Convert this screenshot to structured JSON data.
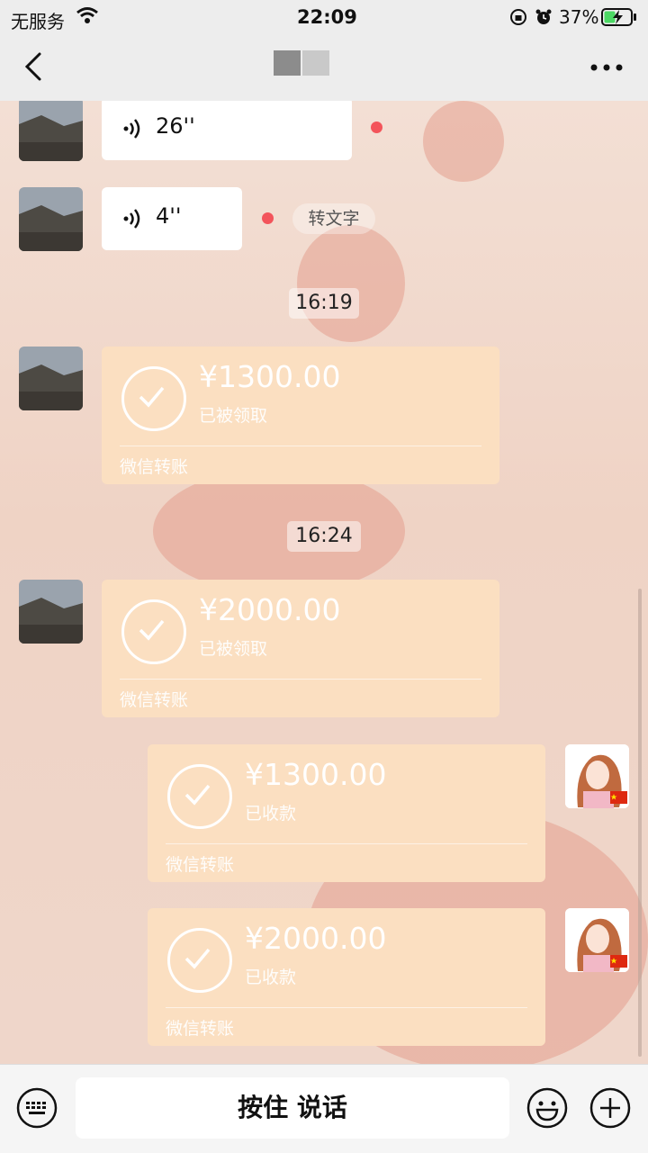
{
  "status_bar": {
    "carrier": "无服务",
    "time": "22:09",
    "battery": "37%"
  },
  "nav": {
    "back_icon": "chevron-left-icon",
    "more_icon": "more-dots-icon"
  },
  "messages": {
    "voice1": {
      "duration": "26''"
    },
    "voice2": {
      "duration": "4''",
      "to_text": "转文字"
    },
    "time1": "16:19",
    "transfer1": {
      "amount": "¥1300.00",
      "state": "已被领取",
      "label": "微信转账"
    },
    "time2": "16:24",
    "transfer2": {
      "amount": "¥2000.00",
      "state": "已被领取",
      "label": "微信转账"
    },
    "transfer3": {
      "amount": "¥1300.00",
      "state": "已收款",
      "label": "微信转账"
    },
    "transfer4": {
      "amount": "¥2000.00",
      "state": "已收款",
      "label": "微信转账"
    }
  },
  "bottom_bar": {
    "talk_label": "按住 说话"
  },
  "colors": {
    "transfer_bg": "#fbdfc1",
    "unread_dot": "#f3545b",
    "bar_bg": "#ededed"
  }
}
